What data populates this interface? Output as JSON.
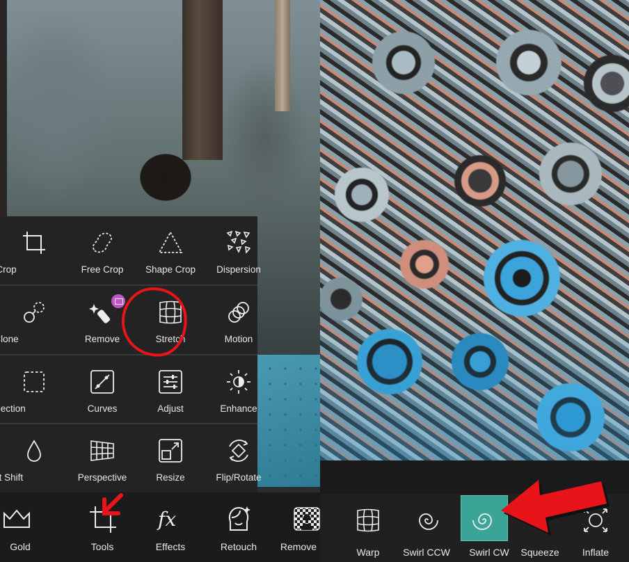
{
  "left_panel": {
    "tools_grid": [
      [
        {
          "label": "Crop",
          "icon": "crop-icon"
        },
        {
          "label": "Free Crop",
          "icon": "free-crop-icon"
        },
        {
          "label": "Shape Crop",
          "icon": "shape-crop-icon"
        },
        {
          "label": "Dispersion",
          "icon": "dispersion-icon"
        }
      ],
      [
        {
          "label": "Clone",
          "icon": "clone-icon"
        },
        {
          "label": "Remove",
          "icon": "remove-icon",
          "premium": true
        },
        {
          "label": "Stretch",
          "icon": "stretch-icon",
          "highlighted": true
        },
        {
          "label": "Motion",
          "icon": "motion-icon"
        }
      ],
      [
        {
          "label": "Selection",
          "icon": "selection-icon"
        },
        {
          "label": "Curves",
          "icon": "curves-icon"
        },
        {
          "label": "Adjust",
          "icon": "adjust-icon"
        },
        {
          "label": "Enhance",
          "icon": "enhance-icon"
        }
      ],
      [
        {
          "label": "Tilt Shift",
          "icon": "tilt-shift-icon"
        },
        {
          "label": "Perspective",
          "icon": "perspective-icon"
        },
        {
          "label": "Resize",
          "icon": "resize-icon"
        },
        {
          "label": "Flip/Rotate",
          "icon": "flip-rotate-icon"
        }
      ]
    ],
    "bottom_nav": [
      {
        "label": "Gold",
        "icon": "crown-icon"
      },
      {
        "label": "Tools",
        "icon": "crop-icon",
        "active": true
      },
      {
        "label": "Effects",
        "icon": "fx-icon"
      },
      {
        "label": "Retouch",
        "icon": "face-icon"
      },
      {
        "label": "Remove BG",
        "icon": "remove-bg-icon",
        "premium": true
      }
    ]
  },
  "right_panel": {
    "effects": [
      {
        "label": "Warp",
        "icon": "warp-grid-icon"
      },
      {
        "label": "Swirl CCW",
        "icon": "swirl-ccw-icon"
      },
      {
        "label": "Swirl CW",
        "icon": "swirl-cw-icon",
        "active": true
      },
      {
        "label": "Squeeze",
        "icon": "squeeze-icon"
      },
      {
        "label": "Inflate",
        "icon": "inflate-icon"
      }
    ]
  },
  "colors": {
    "panel_bg": "#232323",
    "active_effect": "#3aa596",
    "annotation_red": "#e8141a",
    "premium_badge": "#c154c8"
  }
}
